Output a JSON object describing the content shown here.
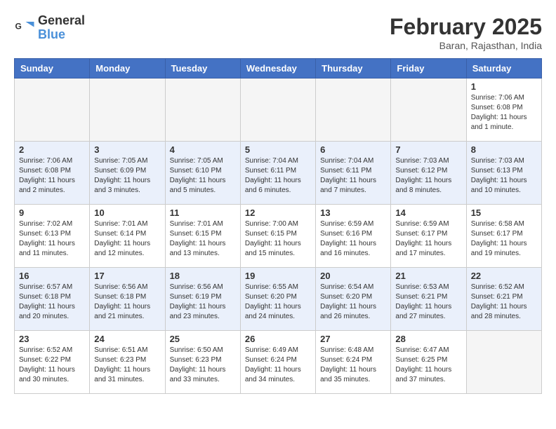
{
  "logo": {
    "general": "General",
    "blue": "Blue"
  },
  "title": "February 2025",
  "subtitle": "Baran, Rajasthan, India",
  "days_of_week": [
    "Sunday",
    "Monday",
    "Tuesday",
    "Wednesday",
    "Thursday",
    "Friday",
    "Saturday"
  ],
  "weeks": [
    [
      {
        "day": "",
        "info": ""
      },
      {
        "day": "",
        "info": ""
      },
      {
        "day": "",
        "info": ""
      },
      {
        "day": "",
        "info": ""
      },
      {
        "day": "",
        "info": ""
      },
      {
        "day": "",
        "info": ""
      },
      {
        "day": "1",
        "info": "Sunrise: 7:06 AM\nSunset: 6:08 PM\nDaylight: 11 hours\nand 1 minute."
      }
    ],
    [
      {
        "day": "2",
        "info": "Sunrise: 7:06 AM\nSunset: 6:08 PM\nDaylight: 11 hours\nand 2 minutes."
      },
      {
        "day": "3",
        "info": "Sunrise: 7:05 AM\nSunset: 6:09 PM\nDaylight: 11 hours\nand 3 minutes."
      },
      {
        "day": "4",
        "info": "Sunrise: 7:05 AM\nSunset: 6:10 PM\nDaylight: 11 hours\nand 5 minutes."
      },
      {
        "day": "5",
        "info": "Sunrise: 7:04 AM\nSunset: 6:11 PM\nDaylight: 11 hours\nand 6 minutes."
      },
      {
        "day": "6",
        "info": "Sunrise: 7:04 AM\nSunset: 6:11 PM\nDaylight: 11 hours\nand 7 minutes."
      },
      {
        "day": "7",
        "info": "Sunrise: 7:03 AM\nSunset: 6:12 PM\nDaylight: 11 hours\nand 8 minutes."
      },
      {
        "day": "8",
        "info": "Sunrise: 7:03 AM\nSunset: 6:13 PM\nDaylight: 11 hours\nand 10 minutes."
      }
    ],
    [
      {
        "day": "9",
        "info": "Sunrise: 7:02 AM\nSunset: 6:13 PM\nDaylight: 11 hours\nand 11 minutes."
      },
      {
        "day": "10",
        "info": "Sunrise: 7:01 AM\nSunset: 6:14 PM\nDaylight: 11 hours\nand 12 minutes."
      },
      {
        "day": "11",
        "info": "Sunrise: 7:01 AM\nSunset: 6:15 PM\nDaylight: 11 hours\nand 13 minutes."
      },
      {
        "day": "12",
        "info": "Sunrise: 7:00 AM\nSunset: 6:15 PM\nDaylight: 11 hours\nand 15 minutes."
      },
      {
        "day": "13",
        "info": "Sunrise: 6:59 AM\nSunset: 6:16 PM\nDaylight: 11 hours\nand 16 minutes."
      },
      {
        "day": "14",
        "info": "Sunrise: 6:59 AM\nSunset: 6:17 PM\nDaylight: 11 hours\nand 17 minutes."
      },
      {
        "day": "15",
        "info": "Sunrise: 6:58 AM\nSunset: 6:17 PM\nDaylight: 11 hours\nand 19 minutes."
      }
    ],
    [
      {
        "day": "16",
        "info": "Sunrise: 6:57 AM\nSunset: 6:18 PM\nDaylight: 11 hours\nand 20 minutes."
      },
      {
        "day": "17",
        "info": "Sunrise: 6:56 AM\nSunset: 6:18 PM\nDaylight: 11 hours\nand 21 minutes."
      },
      {
        "day": "18",
        "info": "Sunrise: 6:56 AM\nSunset: 6:19 PM\nDaylight: 11 hours\nand 23 minutes."
      },
      {
        "day": "19",
        "info": "Sunrise: 6:55 AM\nSunset: 6:20 PM\nDaylight: 11 hours\nand 24 minutes."
      },
      {
        "day": "20",
        "info": "Sunrise: 6:54 AM\nSunset: 6:20 PM\nDaylight: 11 hours\nand 26 minutes."
      },
      {
        "day": "21",
        "info": "Sunrise: 6:53 AM\nSunset: 6:21 PM\nDaylight: 11 hours\nand 27 minutes."
      },
      {
        "day": "22",
        "info": "Sunrise: 6:52 AM\nSunset: 6:21 PM\nDaylight: 11 hours\nand 28 minutes."
      }
    ],
    [
      {
        "day": "23",
        "info": "Sunrise: 6:52 AM\nSunset: 6:22 PM\nDaylight: 11 hours\nand 30 minutes."
      },
      {
        "day": "24",
        "info": "Sunrise: 6:51 AM\nSunset: 6:23 PM\nDaylight: 11 hours\nand 31 minutes."
      },
      {
        "day": "25",
        "info": "Sunrise: 6:50 AM\nSunset: 6:23 PM\nDaylight: 11 hours\nand 33 minutes."
      },
      {
        "day": "26",
        "info": "Sunrise: 6:49 AM\nSunset: 6:24 PM\nDaylight: 11 hours\nand 34 minutes."
      },
      {
        "day": "27",
        "info": "Sunrise: 6:48 AM\nSunset: 6:24 PM\nDaylight: 11 hours\nand 35 minutes."
      },
      {
        "day": "28",
        "info": "Sunrise: 6:47 AM\nSunset: 6:25 PM\nDaylight: 11 hours\nand 37 minutes."
      },
      {
        "day": "",
        "info": ""
      }
    ]
  ]
}
